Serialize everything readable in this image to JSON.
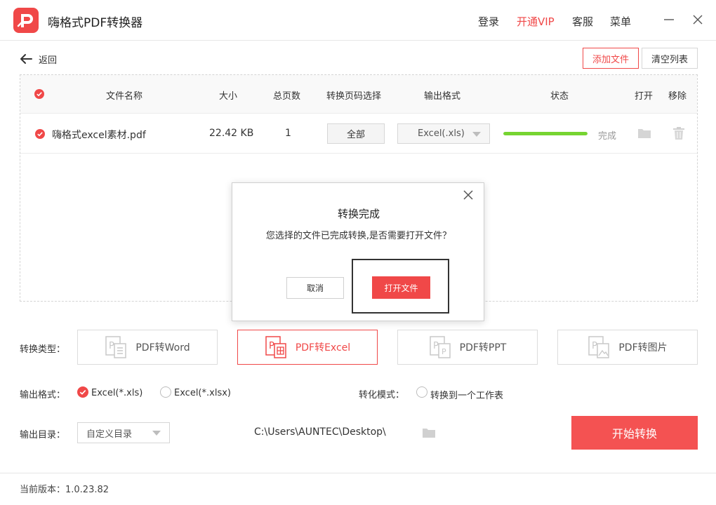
{
  "app": {
    "title": "嗨格式PDF转换器"
  },
  "nav": {
    "login": "登录",
    "vip": "开通VIP",
    "service": "客服",
    "menu": "菜单"
  },
  "toolbar": {
    "back": "返回",
    "add_file": "添加文件",
    "clear_list": "清空列表"
  },
  "table": {
    "headers": {
      "name": "文件名称",
      "size": "大小",
      "pages": "总页数",
      "range": "转换页码选择",
      "format": "输出格式",
      "status": "状态",
      "open": "打开",
      "remove": "移除"
    },
    "rows": [
      {
        "name": "嗨格式excel素材.pdf",
        "size": "22.42 KB",
        "pages": "1",
        "range": "全部",
        "format": "Excel(.xls)",
        "progress": 1.0,
        "status": "完成"
      }
    ]
  },
  "modal": {
    "title": "转换完成",
    "message": "您选择的文件已完成转换,是否需要打开文件？",
    "cancel": "取消",
    "open": "打开文件"
  },
  "convert_type": {
    "label": "转换类型：",
    "options": [
      "PDF转Word",
      "PDF转Excel",
      "PDF转PPT",
      "PDF转图片"
    ],
    "selected": "PDF转Excel"
  },
  "output_format": {
    "label": "输出格式：",
    "options": [
      "Excel(*.xls)",
      "Excel(*.xlsx)"
    ],
    "selected": "Excel(*.xls)"
  },
  "convert_mode": {
    "label": "转化模式：",
    "option": "转换到一个工作表"
  },
  "output_dir": {
    "label": "输出目录：",
    "select": "自定义目录",
    "path": "C:\\Users\\AUNTEC\\Desktop\\"
  },
  "start_button": "开始转换",
  "footer": {
    "version": "当前版本：1.0.23.82"
  },
  "colors": {
    "accent": "#f04848",
    "progress": "#76d431"
  }
}
